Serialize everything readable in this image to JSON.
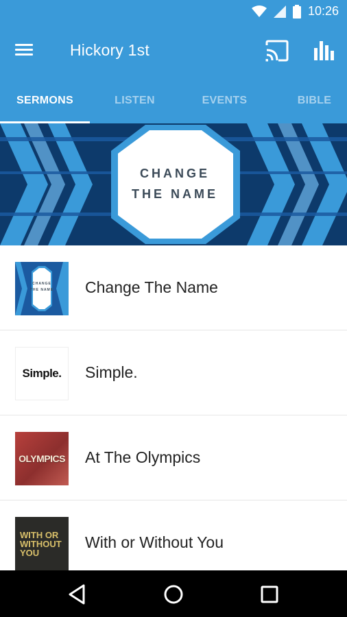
{
  "status_bar": {
    "time": "10:26",
    "icons": [
      "wifi-icon",
      "signal-icon",
      "battery-icon"
    ]
  },
  "app_bar": {
    "title": "Hickory 1st",
    "icons": [
      "menu-icon",
      "cast-icon",
      "stats-icon"
    ]
  },
  "tabs": [
    {
      "label": "SERMONS",
      "active": true
    },
    {
      "label": "LISTEN",
      "active": false
    },
    {
      "label": "EVENTS",
      "active": false
    },
    {
      "label": "BIBLE",
      "active": false
    }
  ],
  "banner": {
    "line1": "CHANGE",
    "line2": "THE NAME"
  },
  "sermons": [
    {
      "title": "Change The Name",
      "thumb_text_1": "CHANGE",
      "thumb_text_2": "THE NAME"
    },
    {
      "title": "Simple.",
      "thumb_text": "Simple."
    },
    {
      "title": "At The Olympics",
      "thumb_text": "OLYMPICS"
    },
    {
      "title": "With or Without You",
      "thumb_text": "WITH OR\nWITHOUT\nYOU"
    }
  ],
  "nav_bar": {
    "icons": [
      "back-icon",
      "home-icon",
      "recents-icon"
    ]
  },
  "colors": {
    "primary": "#3a9ad9",
    "banner_dark": "#0d3a6b",
    "text": "#222222"
  }
}
